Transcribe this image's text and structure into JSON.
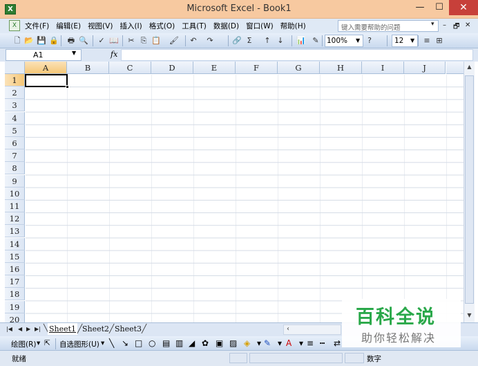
{
  "window": {
    "title": "Microsoft Excel - Book1",
    "minimize": "—",
    "maximize": "☐",
    "close": "✕"
  },
  "menubar": {
    "items": [
      "文件(F)",
      "编辑(E)",
      "视图(V)",
      "插入(I)",
      "格式(O)",
      "工具(T)",
      "数据(D)",
      "窗口(W)",
      "帮助(H)"
    ],
    "help_placeholder": "键入需要帮助的问题",
    "doc_controls": [
      "▾",
      "–",
      "🗗",
      "✕"
    ]
  },
  "toolbar": {
    "zoom": "100%",
    "font_size": "12",
    "buttons": [
      {
        "name": "new-icon",
        "glyph": "🗋"
      },
      {
        "name": "open-icon",
        "glyph": "📂"
      },
      {
        "name": "save-icon",
        "glyph": "💾"
      },
      {
        "name": "permission-icon",
        "glyph": "🔒"
      },
      {
        "name": "print-icon",
        "glyph": "🖶"
      },
      {
        "name": "print-preview-icon",
        "glyph": "🔍"
      },
      {
        "name": "spelling-icon",
        "glyph": "✓"
      },
      {
        "name": "research-icon",
        "glyph": "📖"
      },
      {
        "name": "cut-icon",
        "glyph": "✂"
      },
      {
        "name": "copy-icon",
        "glyph": "⎘"
      },
      {
        "name": "paste-icon",
        "glyph": "📋"
      },
      {
        "name": "format-painter-icon",
        "glyph": "🖌"
      },
      {
        "name": "undo-icon",
        "glyph": "↶"
      },
      {
        "name": "redo-icon",
        "glyph": "↷"
      },
      {
        "name": "hyperlink-icon",
        "glyph": "🔗"
      },
      {
        "name": "autosum-icon",
        "glyph": "Σ"
      },
      {
        "name": "sort-ascending-icon",
        "glyph": "↑"
      },
      {
        "name": "sort-descending-icon",
        "glyph": "↓"
      },
      {
        "name": "chart-wizard-icon",
        "glyph": "📊"
      },
      {
        "name": "drawing-icon",
        "glyph": "✎"
      },
      {
        "name": "help-icon",
        "glyph": "?"
      },
      {
        "name": "align-icon",
        "glyph": "≡"
      },
      {
        "name": "merge-icon",
        "glyph": "⊞"
      }
    ]
  },
  "formula_bar": {
    "name_box": "A1",
    "fx": "fx"
  },
  "grid": {
    "columns": [
      "A",
      "B",
      "C",
      "D",
      "E",
      "F",
      "G",
      "H",
      "I",
      "J"
    ],
    "rows": [
      "1",
      "2",
      "3",
      "4",
      "5",
      "6",
      "7",
      "8",
      "9",
      "10",
      "11",
      "12",
      "13",
      "14",
      "15",
      "16",
      "17",
      "18",
      "19",
      "20"
    ],
    "active_cell": "A1"
  },
  "sheets": {
    "tabs": [
      "Sheet1",
      "Sheet2",
      "Sheet3"
    ],
    "active": "Sheet1",
    "nav": [
      "|◀",
      "◀",
      "▶",
      "▶|"
    ]
  },
  "drawing_bar": {
    "draw_label": "绘图(R)",
    "autoshapes_label": "自选图形(U)"
  },
  "status": {
    "ready": "就绪",
    "num": "数字"
  },
  "watermark": {
    "title": "百科全说",
    "subtitle": "助你轻松解决"
  }
}
